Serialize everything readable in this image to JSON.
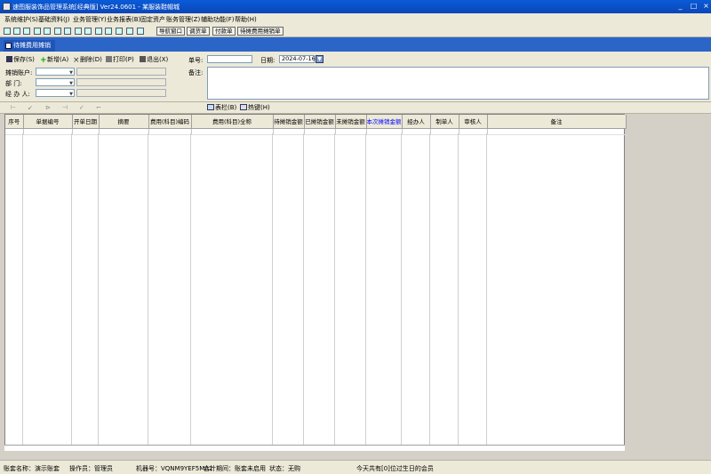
{
  "window": {
    "title": "速图服装饰品管理系统[经典版] Ver24.0601  - 某服装鞋帽城",
    "controls": [
      "_",
      "□",
      "×"
    ]
  },
  "menu": [
    "系统维护(S)",
    "基础资料(J)",
    "业务管理(Y)",
    "业务报表(B)",
    "固定资产",
    "账务管理(Z)",
    "辅助功能(F)",
    "帮助(H)"
  ],
  "toolbar": {
    "buttons": [
      "导航窗口",
      "调货单",
      "付款单",
      "待摊费用摊销单"
    ]
  },
  "tab": {
    "label": "待摊费用摊销单"
  },
  "actions": {
    "save": "保存(S)",
    "add": "新增(A)",
    "delete": "删除(D)",
    "print": "打印(P)",
    "exit": "退出(X)"
  },
  "form": {
    "doc_no_label": "单号:",
    "doc_no_value": "",
    "date_label": "日期:",
    "date_value": "2024-07-16",
    "account_label": "摊销账户:",
    "dept_label": "部    门:",
    "handler_label": "经 办 人:",
    "remark_label": "备注:"
  },
  "toolbar2": {
    "columns_button": "表栏(B)",
    "hotkey_button": "热键(H)"
  },
  "grid": {
    "columns": [
      "序号",
      "单据编号",
      "开单日期",
      "摘要",
      "费用(科目)编码",
      "费用(科目)全称",
      "待摊销金额",
      "已摊销金额",
      "未摊销金额",
      "本次摊销金额",
      "经办人",
      "制单人",
      "审核人",
      "备注"
    ],
    "highlight_column": "本次摊销金额"
  },
  "statusbar": {
    "account_set": "账套名称：演示账套",
    "operator": "操作员：管理员",
    "machine": "机器号：VQNM9YEF5MA2",
    "period": "会计期间：账套未启用",
    "state": "状态：无购",
    "birthday": "今天共有[0]位过生日的会员"
  },
  "colors": {
    "title_bar": "#0b4fc8",
    "tab_strip": "#2c65c8",
    "highlight_header": "#0000ff"
  }
}
